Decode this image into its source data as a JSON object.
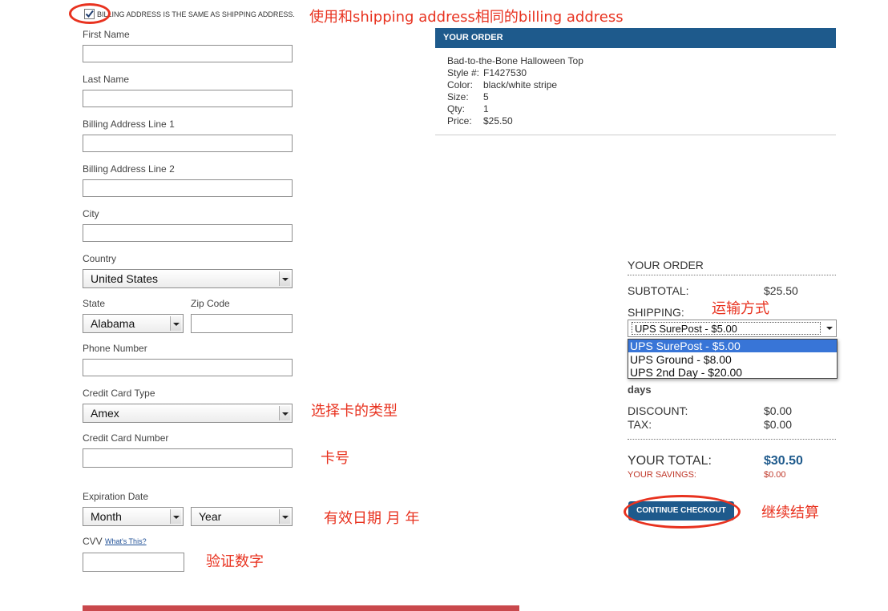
{
  "billing_checkbox": {
    "label": "BILLING ADDRESS IS THE SAME AS SHIPPING ADDRESS.",
    "checked": true
  },
  "form": {
    "first_name": {
      "label": "First Name",
      "value": ""
    },
    "last_name": {
      "label": "Last Name",
      "value": ""
    },
    "address1": {
      "label": "Billing Address Line 1",
      "value": ""
    },
    "address2": {
      "label": "Billing Address Line 2",
      "value": ""
    },
    "city": {
      "label": "City",
      "value": ""
    },
    "country": {
      "label": "Country",
      "value": "United States"
    },
    "state": {
      "label": "State",
      "value": "Alabama"
    },
    "zip": {
      "label": "Zip Code",
      "value": ""
    },
    "phone": {
      "label": "Phone Number",
      "value": ""
    },
    "card_type": {
      "label": "Credit Card Type",
      "value": "Amex"
    },
    "card_number": {
      "label": "Credit Card Number",
      "value": ""
    },
    "expiration": {
      "label": "Expiration Date",
      "month": "Month",
      "year": "Year"
    },
    "cvv": {
      "label": "CVV",
      "help_link": "What's This?",
      "value": ""
    }
  },
  "order_box": {
    "header": "YOUR ORDER",
    "item_name": "Bad-to-the-Bone Halloween Top",
    "details": [
      {
        "key": "Style #:",
        "value": "F1427530"
      },
      {
        "key": "Color:",
        "value": "black/white stripe"
      },
      {
        "key": "Size:",
        "value": "5"
      },
      {
        "key": "Qty:",
        "value": "1"
      },
      {
        "key": "Price:",
        "value": "$25.50"
      }
    ]
  },
  "summary": {
    "title": "YOUR ORDER",
    "subtotal_label": "SUBTOTAL:",
    "subtotal": "$25.50",
    "shipping_label": "SHIPPING:",
    "shipping_selected": "UPS SurePost - $5.00",
    "shipping_options": [
      "UPS SurePost - $5.00",
      "UPS Ground - $8.00",
      "UPS 2nd Day - $20.00"
    ],
    "days_text": "days",
    "discount_label": "DISCOUNT:",
    "discount": "$0.00",
    "tax_label": "TAX:",
    "tax": "$0.00",
    "total_label": "YOUR TOTAL:",
    "total": "$30.50",
    "savings_label": "YOUR SAVINGS:",
    "savings": "$0.00",
    "checkout_button": "CONTINUE CHECKOUT"
  },
  "annotations": {
    "billing": "使用和shipping address相同的billing address",
    "shipping": "运输方式",
    "card_type": "选择卡的类型",
    "card_number": "卡号",
    "expiration": "有效日期 月 年",
    "cvv": "验证数字",
    "checkout": "继续结算"
  },
  "colors": {
    "header_bg": "#1e5a8c",
    "annotation": "#e8321f",
    "total": "#1e5a8c",
    "savings": "#c0392b",
    "bottom_bar": "#c9484c"
  }
}
